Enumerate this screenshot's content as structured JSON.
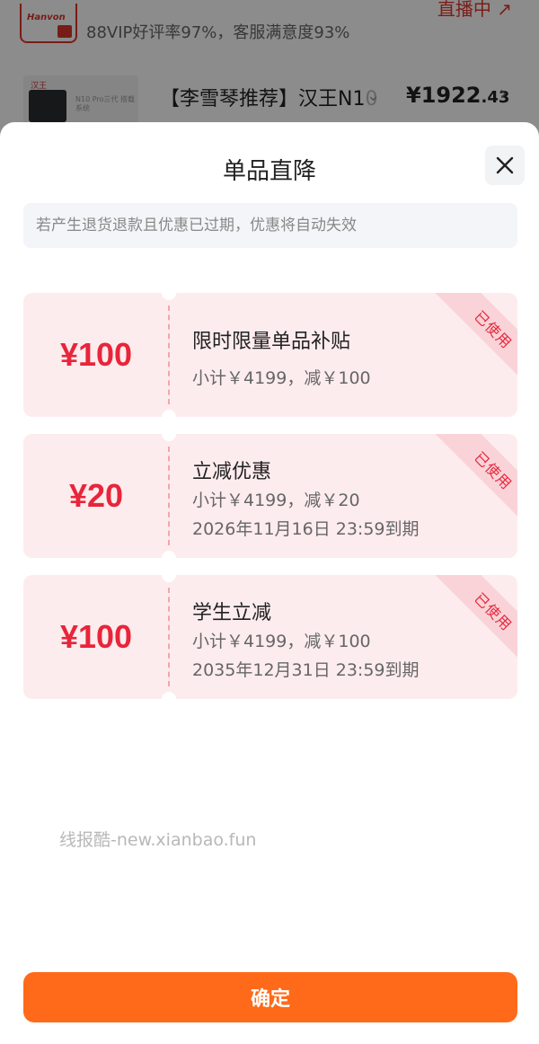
{
  "background": {
    "logo_text": "Hanvon",
    "rating_text": "88VIP好评率97%，客服满意度93%",
    "live_label": "直播中 ↗",
    "thumb_logo": "汉王",
    "thumb_text": "N10 Pro三代 搭载系统",
    "product_title": "【李雪琴推荐】汉王N1",
    "product_title_fade": "0",
    "price_main": "¥1922",
    "price_decimal": ".43"
  },
  "sheet": {
    "title": "单品直降",
    "notice": "若产生退货退款且优惠已过期，优惠将自动失效",
    "confirm_label": "确定"
  },
  "coupons": [
    {
      "amount": "¥100",
      "name": "限时限量单品补贴",
      "subtotal": "小计￥4199，减￥100",
      "expiry": "",
      "stamp": "已使用"
    },
    {
      "amount": "¥20",
      "name": "立减优惠",
      "subtotal": "小计￥4199，减￥20",
      "expiry": "2026年11月16日 23:59到期",
      "stamp": "已使用"
    },
    {
      "amount": "¥100",
      "name": "学生立减",
      "subtotal": "小计￥4199，减￥100",
      "expiry": "2035年12月31日 23:59到期",
      "stamp": "已使用"
    }
  ],
  "watermark": "线报酷-new.xianbao.fun",
  "colors": {
    "accent": "#ff6a1a",
    "coupon_red": "#e8253a",
    "coupon_bg": "#fdecee"
  },
  "icons": {
    "close": "close-icon",
    "chevron": "chevron-down-icon",
    "arrow": "chevron-right-icon"
  }
}
